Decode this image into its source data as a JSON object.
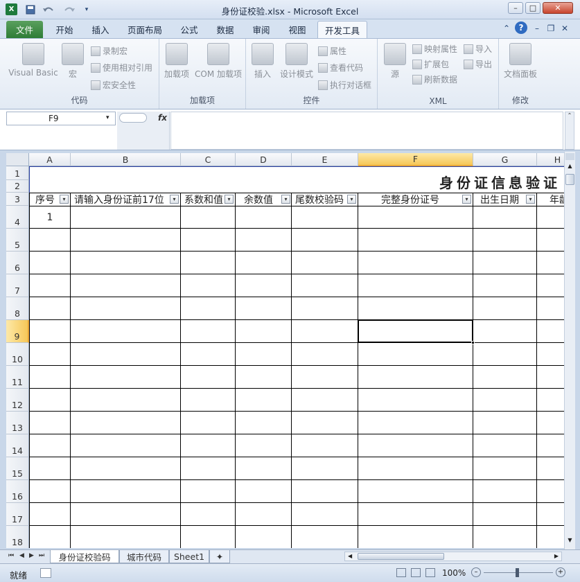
{
  "window": {
    "title": "身份证校验.xlsx - Microsoft Excel"
  },
  "quick_access": {
    "logo": "X",
    "save_icon": "save-icon",
    "undo_icon": "undo-icon",
    "redo_icon": "redo-icon"
  },
  "window_buttons": {
    "minimize": "–",
    "maximize": "□",
    "close": "✕"
  },
  "tabs": [
    {
      "label": "文件"
    },
    {
      "label": "开始"
    },
    {
      "label": "插入"
    },
    {
      "label": "页面布局"
    },
    {
      "label": "公式"
    },
    {
      "label": "数据"
    },
    {
      "label": "审阅"
    },
    {
      "label": "视图"
    },
    {
      "label": "开发工具"
    }
  ],
  "ribbon": {
    "code": {
      "label": "代码",
      "visual_basic": "Visual Basic",
      "macro": "宏",
      "record_macro": "录制宏",
      "relative_ref": "使用相对引用",
      "macro_security": "宏安全性"
    },
    "addins": {
      "label": "加载项",
      "addins": "加载项",
      "com_addins": "COM 加载项"
    },
    "controls": {
      "label": "控件",
      "insert": "插入",
      "design_mode": "设计模式",
      "properties": "属性",
      "view_code": "查看代码",
      "run_dialog": "执行对话框"
    },
    "xml": {
      "label": "XML",
      "source": "源",
      "map_properties": "映射属性",
      "expansion_packs": "扩展包",
      "refresh_data": "刷新数据",
      "import": "导入",
      "export": "导出"
    },
    "modify": {
      "label": "修改",
      "document_panel": "文档面板"
    }
  },
  "formula_bar": {
    "name_box": "F9",
    "fx": "fx",
    "formula": ""
  },
  "columns": [
    "A",
    "B",
    "C",
    "D",
    "E",
    "F",
    "G",
    "H"
  ],
  "selected_column": "F",
  "rows": [
    "1",
    "2",
    "3",
    "4",
    "5",
    "6",
    "7",
    "8",
    "9",
    "10",
    "11",
    "12",
    "13",
    "14",
    "15",
    "16",
    "17",
    "18"
  ],
  "selected_row": "9",
  "sheet": {
    "title": "身份证信息验证",
    "headers": [
      "序号",
      "请输入身份证前17位",
      "系数和值",
      "余数值",
      "尾数校验码",
      "完整身份证号",
      "出生日期",
      "年龄"
    ],
    "cell_a4": "1"
  },
  "sheet_tabs": [
    "身份证校验码",
    "城市代码",
    "Sheet1"
  ],
  "active_sheet": "身份证校验码",
  "status": {
    "ready": "就绪",
    "zoom": "100%"
  }
}
